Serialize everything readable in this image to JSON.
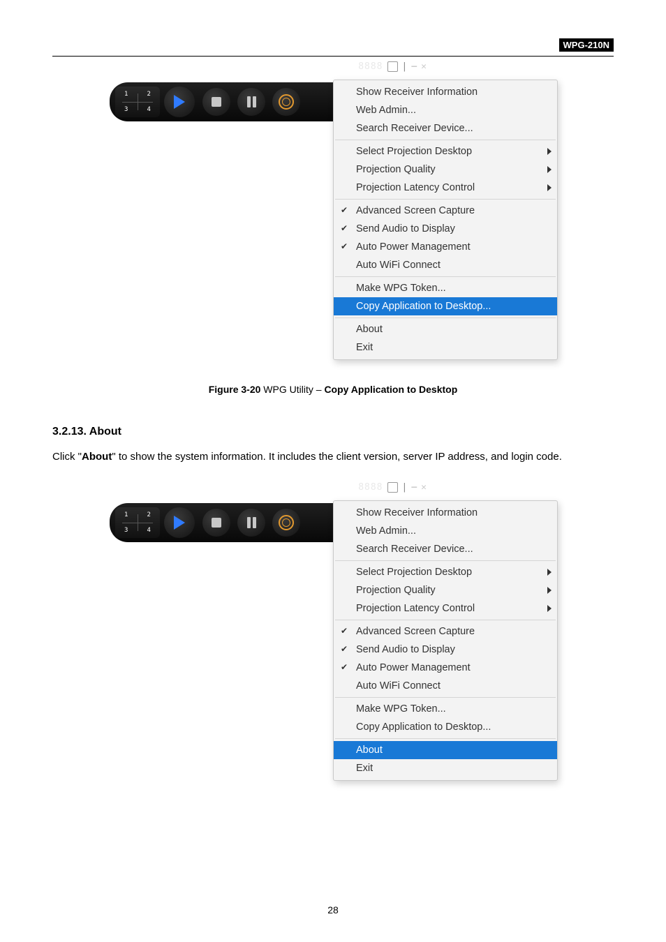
{
  "header": {
    "product": "WPG-210N"
  },
  "bar": {
    "code": "8888",
    "quad": {
      "n1": "1",
      "n2": "2",
      "n3": "3",
      "n4": "4"
    }
  },
  "menu": {
    "group1": [
      {
        "label": "Show Receiver Information",
        "flags": ""
      },
      {
        "label": "Web Admin...",
        "flags": ""
      },
      {
        "label": "Search Receiver Device...",
        "flags": ""
      }
    ],
    "group2": [
      {
        "label": "Select Projection Desktop",
        "flags": "arrow"
      },
      {
        "label": "Projection Quality",
        "flags": "arrow"
      },
      {
        "label": "Projection Latency Control",
        "flags": "arrow"
      }
    ],
    "group3": [
      {
        "label": "Advanced Screen Capture",
        "flags": "check"
      },
      {
        "label": "Send Audio to Display",
        "flags": "check"
      },
      {
        "label": "Auto Power Management",
        "flags": "check"
      },
      {
        "label": "Auto WiFi Connect",
        "flags": ""
      }
    ],
    "group4": [
      {
        "label": "Make WPG Token...",
        "flags": ""
      },
      {
        "label": "Copy Application to Desktop...",
        "flags": ""
      }
    ],
    "group5": [
      {
        "label": "About",
        "flags": ""
      },
      {
        "label": "Exit",
        "flags": ""
      }
    ]
  },
  "fig1": {
    "selected": "Copy Application to Desktop...",
    "caption_label": "Figure 3-20",
    "caption_mid": " WPG Utility – ",
    "caption_bold": "Copy Application to Desktop"
  },
  "section": {
    "num_title": "3.2.13.   About",
    "para_pre": "Click \"",
    "para_bold": "About",
    "para_post": "\" to show the system information. It includes the client version, server IP address, and login code."
  },
  "fig2": {
    "selected": "About"
  },
  "page_number": "28"
}
